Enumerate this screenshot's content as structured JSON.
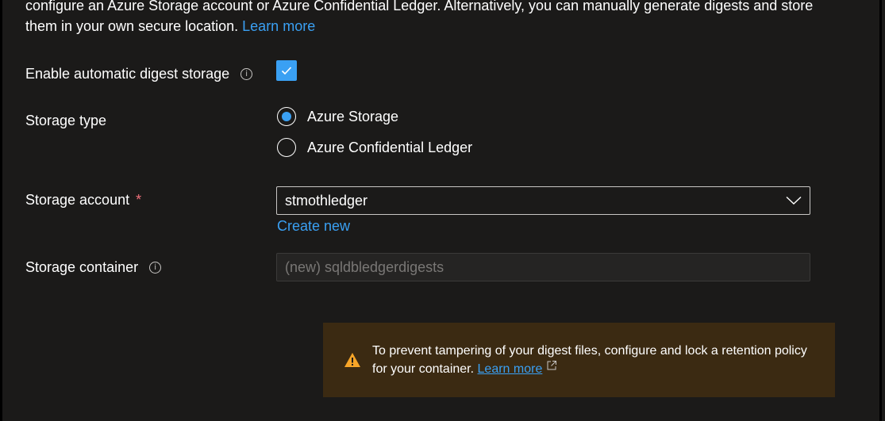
{
  "description": {
    "text": "configure an Azure Storage account or Azure Confidential Ledger. Alternatively, you can manually generate digests and store them in your own secure location.",
    "learn_more": "Learn more"
  },
  "auto_digest": {
    "label": "Enable automatic digest storage",
    "checked": true
  },
  "storage_type": {
    "label": "Storage type",
    "options": [
      "Azure Storage",
      "Azure Confidential Ledger"
    ],
    "selected": "Azure Storage"
  },
  "storage_account": {
    "label": "Storage account",
    "required_mark": "*",
    "value": "stmothledger",
    "create_new": "Create new"
  },
  "storage_container": {
    "label": "Storage container",
    "placeholder": "(new) sqldbledgerdigests"
  },
  "warning": {
    "text": "To prevent tampering of your digest files, configure and lock a retention policy for your container.",
    "learn_more": "Learn more"
  },
  "colors": {
    "background": "#1b1a19",
    "accent": "#3aa0f3",
    "warning_bg": "#3b2a12",
    "warning_icon": "#f7a528",
    "required": "#f1707b"
  },
  "icons": [
    "info-icon",
    "checkmark-icon",
    "chevron-down-icon",
    "warning-icon",
    "external-link-icon"
  ]
}
